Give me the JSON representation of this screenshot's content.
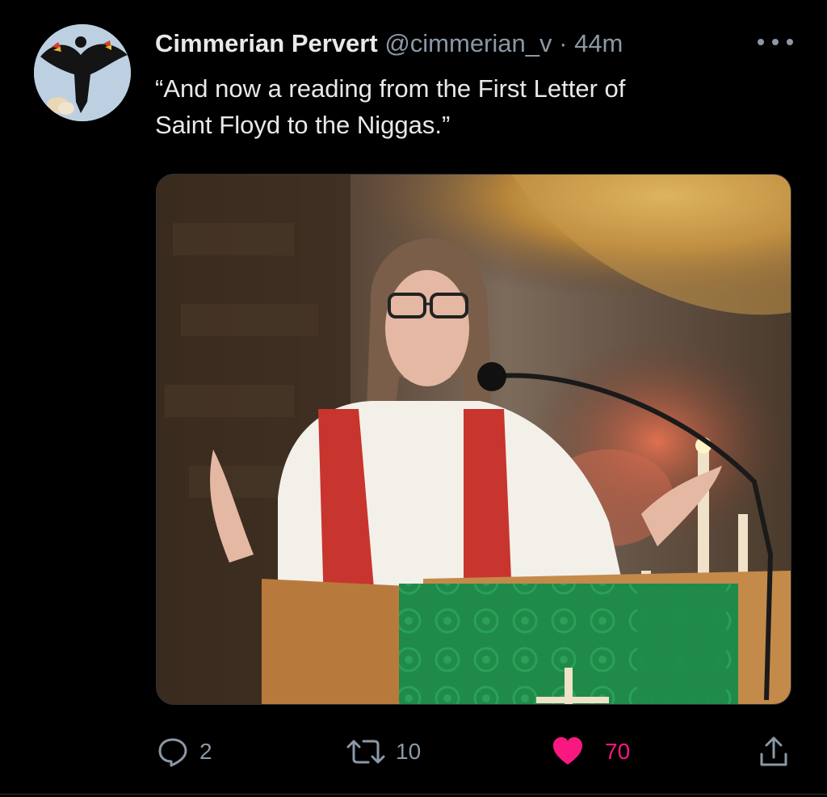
{
  "tweet": {
    "display_name": "Cimmerian Pervert",
    "handle": "@cimmerian_v",
    "separator": "·",
    "time": "44m",
    "text_line1": "“And now a reading from the First Letter of",
    "text_line2": "Saint Floyd to the Niggas.”",
    "avatar_icon": "red-winged-blackbird-avatar",
    "media_description_icon": "photo-image"
  },
  "actions": {
    "reply_count": "2",
    "retweet_count": "10",
    "like_count": "70",
    "like_color": "#f91880",
    "icons": [
      "reply-icon",
      "retweet-icon",
      "heart-icon",
      "share-icon"
    ]
  },
  "colors": {
    "background": "#000000",
    "text_primary": "#e7e9ea",
    "text_secondary": "#8b98a5",
    "like_pink": "#f91880"
  }
}
